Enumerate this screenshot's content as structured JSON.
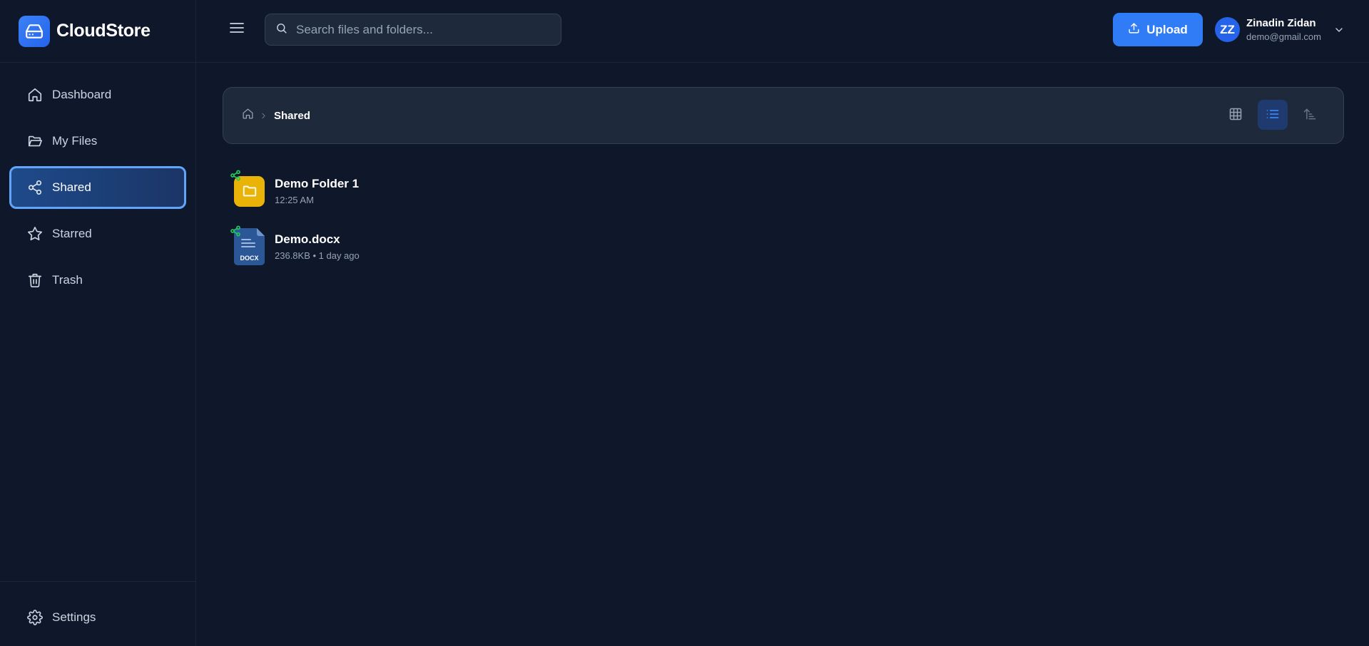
{
  "brand": {
    "name": "CloudStore",
    "icon": "hard-drive-icon"
  },
  "sidebar": {
    "items": [
      {
        "label": "Dashboard",
        "icon": "home-icon",
        "active": false
      },
      {
        "label": "My Files",
        "icon": "folder-open-icon",
        "active": false
      },
      {
        "label": "Shared",
        "icon": "share-icon",
        "active": true
      },
      {
        "label": "Starred",
        "icon": "star-icon",
        "active": false
      },
      {
        "label": "Trash",
        "icon": "trash-icon",
        "active": false
      }
    ],
    "settings_label": "Settings"
  },
  "header": {
    "search_placeholder": "Search files and folders...",
    "search_value": "",
    "upload_label": "Upload",
    "user": {
      "initials": "ZZ",
      "name": "Zinadin Zidan",
      "email": "demo@gmail.com"
    }
  },
  "breadcrumb": {
    "current": "Shared"
  },
  "view": {
    "mode": "list"
  },
  "files": [
    {
      "name": "Demo Folder 1",
      "meta": "12:25 AM",
      "type": "folder",
      "shared": true
    },
    {
      "name": "Demo.docx",
      "meta": "236.8KB • 1 day ago",
      "type": "docx",
      "type_label": "DOCX",
      "shared": true
    }
  ],
  "colors": {
    "background": "#0f172a",
    "accent": "#2f7cf6",
    "folder": "#eab308",
    "share_badge": "#22c55e"
  }
}
